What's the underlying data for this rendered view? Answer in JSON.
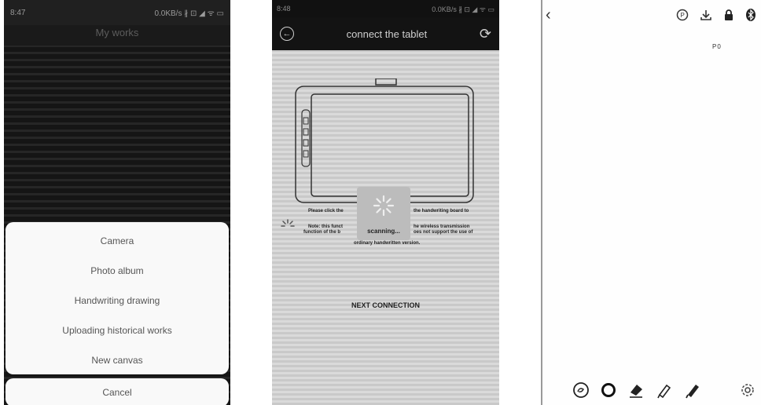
{
  "screen1": {
    "status": {
      "time": "8:47",
      "right": "0.0KB/s ∦ ⊡ ◢ ᯤ ▭"
    },
    "title": "My works",
    "sheet": {
      "items": [
        {
          "label": "Camera"
        },
        {
          "label": "Photo album"
        },
        {
          "label": "Handwriting drawing"
        },
        {
          "label": "Uploading historical works"
        },
        {
          "label": "New canvas"
        }
      ],
      "cancel": "Cancel"
    }
  },
  "screen2": {
    "status": {
      "time": "8:48",
      "right": "0.0KB/s ∦ ⊡ ◢ ᯤ ▭"
    },
    "header": {
      "title": "connect the tablet",
      "back_icon": "back-arrow-icon",
      "refresh_icon": "refresh-icon"
    },
    "instruction_left": "Please click the",
    "instruction_right": "the handwriting board to",
    "note_left_1": "Note: this funct",
    "note_left_2": "function of the b",
    "note_right_1": "he wireless transmission",
    "note_right_2": "oes not support the use of",
    "note_bottom": "ordinary handwritten version.",
    "scanning": "scanning...",
    "next_connection": "NEXT CONNECTION"
  },
  "screen3": {
    "top_icons": [
      "play-circle-icon",
      "download-icon",
      "lock-icon",
      "bluetooth-icon"
    ],
    "page_label": "P0",
    "tools": [
      "lasso-icon",
      "circle-brush-icon",
      "eraser-icon",
      "marker-icon",
      "pen-icon"
    ],
    "settings_icon": "settings-gear-icon"
  }
}
